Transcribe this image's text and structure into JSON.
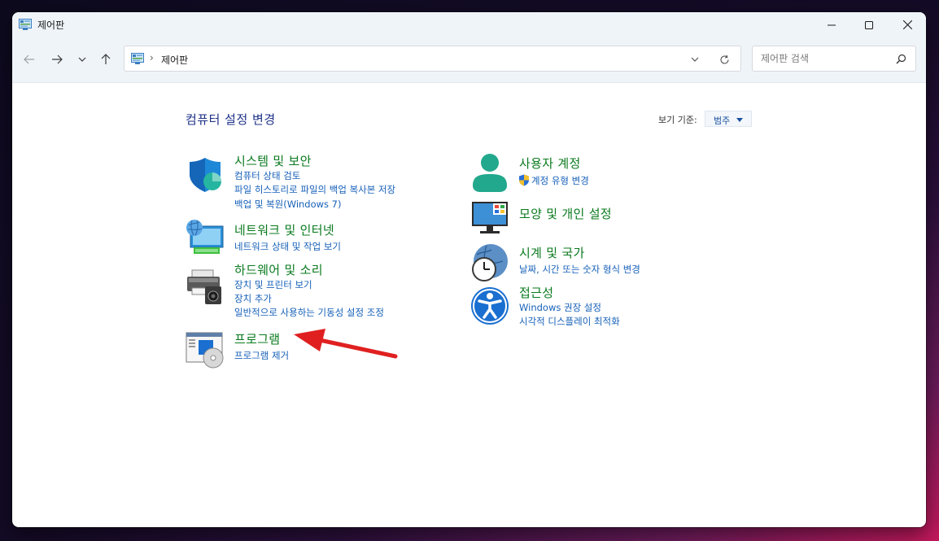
{
  "window": {
    "title": "제어판"
  },
  "address": {
    "path": "제어판",
    "separator": "›"
  },
  "search": {
    "placeholder": "제어판 검색"
  },
  "heading": "컴퓨터 설정 변경",
  "view_by": {
    "label": "보기 기준:",
    "value": "범주"
  },
  "categories_left": [
    {
      "title": "시스템 및 보안",
      "icon": "shield-icon",
      "links": [
        "컴퓨터 상태 검토",
        "파일 히스토리로 파일의 백업 복사본 저장",
        "백업 및 복원(Windows 7)"
      ]
    },
    {
      "title": "네트워크 및 인터넷",
      "icon": "network-icon",
      "links": [
        "네트워크 상태 및 작업 보기"
      ]
    },
    {
      "title": "하드웨어 및 소리",
      "icon": "printer-speaker-icon",
      "links": [
        "장치 및 프린터 보기",
        "장치 추가",
        "일반적으로 사용하는 기동성 설정 조정"
      ]
    },
    {
      "title": "프로그램",
      "icon": "programs-icon",
      "links": [
        "프로그램 제거"
      ]
    }
  ],
  "categories_right": [
    {
      "title": "사용자 계정",
      "icon": "user-icon",
      "links": [
        "계정 유형 변경"
      ]
    },
    {
      "title": "모양 및 개인 설정",
      "icon": "monitor-icon",
      "links": []
    },
    {
      "title": "시계 및 국가",
      "icon": "clock-globe-icon",
      "links": [
        "날짜, 시간 또는 숫자 형식 변경"
      ]
    },
    {
      "title": "접근성",
      "icon": "accessibility-icon",
      "links": [
        "Windows 권장 설정",
        "시각적 디스플레이 최적화"
      ]
    }
  ],
  "colors": {
    "accent": "#1660b8",
    "category_title": "#0a7a1e",
    "annotation_arrow": "#e02020"
  }
}
